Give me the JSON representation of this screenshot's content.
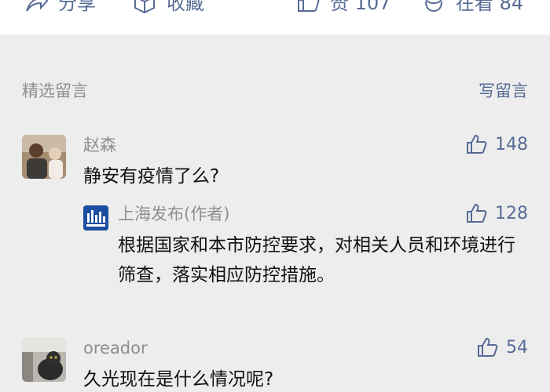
{
  "actions": {
    "share": "分享",
    "favorite": "收藏",
    "like": "赞 107",
    "wow": "在看 84"
  },
  "section": {
    "title": "精选留言",
    "write": "写留言"
  },
  "comments": [
    {
      "name": "赵森",
      "text": "静安有疫情了么?",
      "likes": "148",
      "reply": {
        "name": "上海发布(作者)",
        "text": "根据国家和本市防控要求，对相关人员和环境进行筛查，落实相应防控措施。",
        "likes": "128"
      }
    },
    {
      "name": "oreador",
      "text": "久光现在是什么情况呢?",
      "likes": "54"
    }
  ],
  "colors": {
    "link": "#576b95",
    "muted": "#8e8e93",
    "background": "#ededed"
  }
}
